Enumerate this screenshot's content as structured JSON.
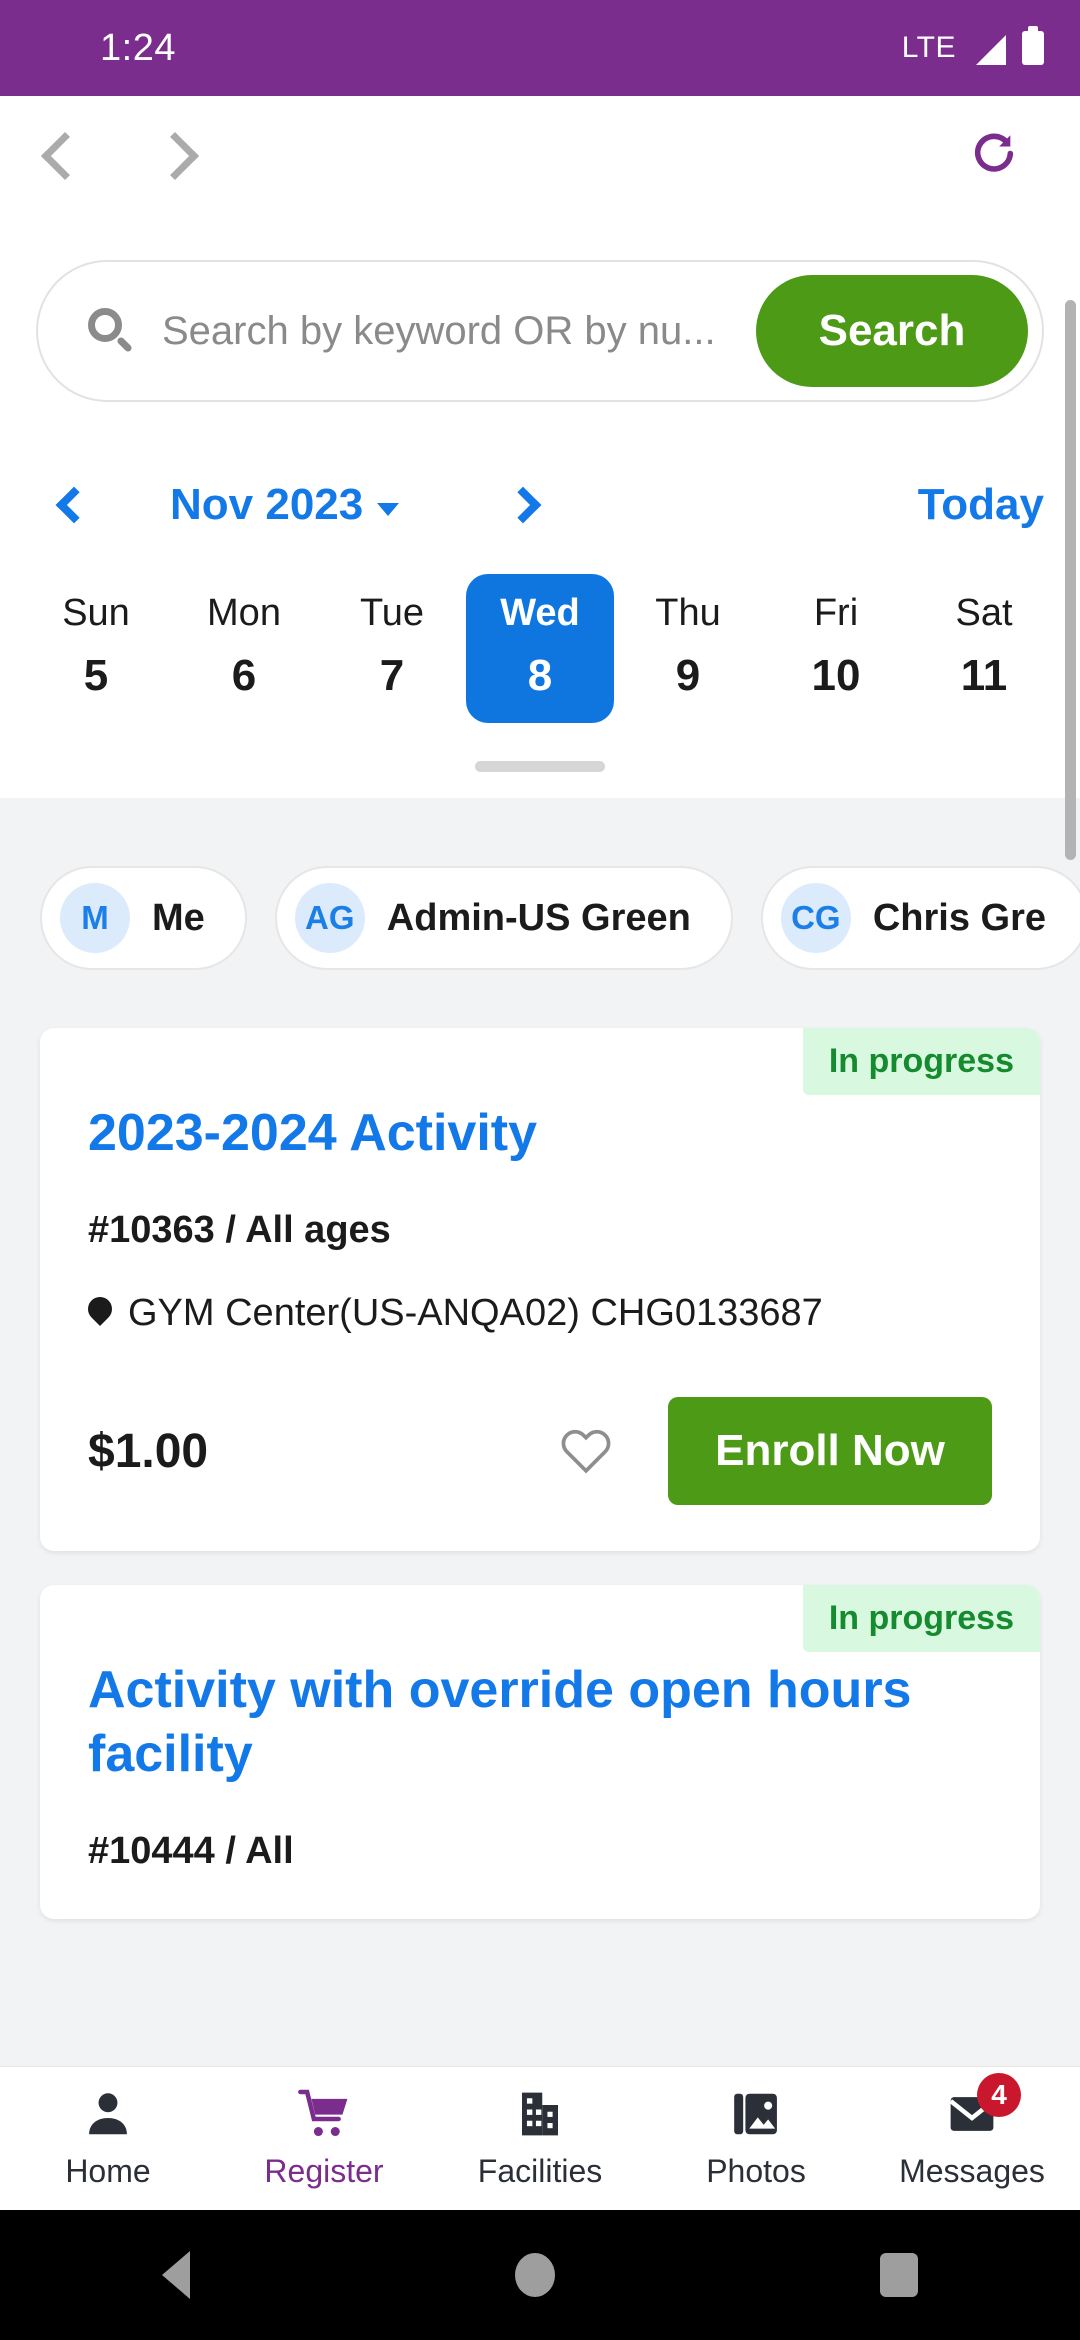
{
  "status_bar": {
    "time": "1:24",
    "network": "LTE",
    "signal_icon": "signal-bars-icon",
    "battery_icon": "battery-full-icon"
  },
  "browser_nav": {
    "back_icon": "chevron-left-icon",
    "forward_icon": "chevron-right-icon",
    "reload_icon": "reload-icon"
  },
  "search": {
    "icon": "search-icon",
    "placeholder": "Search by keyword OR by nu...",
    "value": "",
    "button_label": "Search"
  },
  "calendar": {
    "prev_icon": "chevron-left-icon",
    "next_icon": "chevron-right-icon",
    "month_label": "Nov 2023",
    "caret_icon": "chevron-down-icon",
    "today_label": "Today",
    "days": [
      {
        "dow": "Sun",
        "num": "5",
        "selected": false
      },
      {
        "dow": "Mon",
        "num": "6",
        "selected": false
      },
      {
        "dow": "Tue",
        "num": "7",
        "selected": false
      },
      {
        "dow": "Wed",
        "num": "8",
        "selected": true
      },
      {
        "dow": "Thu",
        "num": "9",
        "selected": false
      },
      {
        "dow": "Fri",
        "num": "10",
        "selected": false
      },
      {
        "dow": "Sat",
        "num": "11",
        "selected": false
      }
    ],
    "selected_color": "#0F76E0",
    "accent_color": "#1378E8"
  },
  "people_chips": [
    {
      "initials": "M",
      "name": "Me"
    },
    {
      "initials": "AG",
      "name": "Admin-US Green"
    },
    {
      "initials": "CG",
      "name": "Chris Gre"
    }
  ],
  "cards": [
    {
      "status": "In progress",
      "title": "2023-2024 Activity",
      "number_and_ages": "#10363 / All ages",
      "location_icon": "location-pin-icon",
      "location": "GYM Center(US-ANQA02) CHG0133687",
      "price": "$1.00",
      "favorite_icon": "heart-outline-icon",
      "enroll_label": "Enroll Now"
    },
    {
      "status": "In progress",
      "title": "Activity with override open hours facility",
      "number_and_ages": "#10444 / All",
      "location_icon": "location-pin-icon",
      "location": "",
      "price": "",
      "favorite_icon": "heart-outline-icon",
      "enroll_label": ""
    }
  ],
  "bottom_nav": [
    {
      "label": "Home",
      "icon": "person-icon",
      "active": false,
      "badge": ""
    },
    {
      "label": "Register",
      "icon": "cart-icon",
      "active": true,
      "badge": ""
    },
    {
      "label": "Facilities",
      "icon": "building-icon",
      "active": false,
      "badge": ""
    },
    {
      "label": "Photos",
      "icon": "photos-icon",
      "active": false,
      "badge": ""
    },
    {
      "label": "Messages",
      "icon": "envelope-icon",
      "active": false,
      "badge": "4"
    }
  ],
  "system_nav": {
    "back_icon": "triangle-back-icon",
    "home_icon": "circle-home-icon",
    "recents_icon": "square-recents-icon"
  },
  "colors": {
    "status_bar_purple": "#7B2D8E",
    "green": "#4C9A16",
    "blue": "#1378E8",
    "badge_red": "#C9172E",
    "status_badge_bg": "#D8F8E0",
    "status_badge_text": "#158A2E"
  }
}
